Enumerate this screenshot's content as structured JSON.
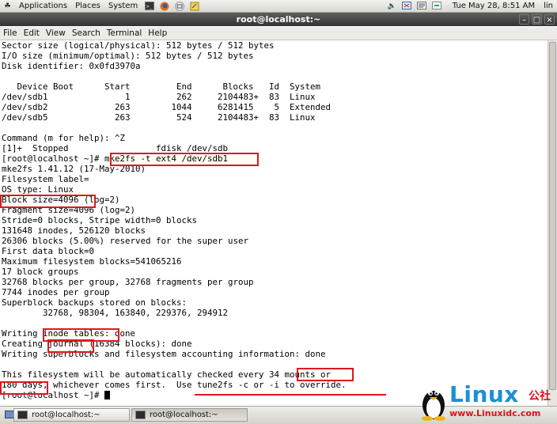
{
  "panel": {
    "applications": "Applications",
    "places": "Places",
    "system": "System",
    "clock": "Tue May 28,  8:51 AM",
    "user": "lin"
  },
  "window": {
    "title": "root@localhost:~",
    "menu": [
      "File",
      "Edit",
      "View",
      "Search",
      "Terminal",
      "Help"
    ]
  },
  "terminal": {
    "lines": [
      "Sector size (logical/physical): 512 bytes / 512 bytes",
      "I/O size (minimum/optimal): 512 bytes / 512 bytes",
      "Disk identifier: 0x0fd3970a",
      "",
      "   Device Boot      Start         End      Blocks   Id  System",
      "/dev/sdb1               1         262     2104483+  83  Linux",
      "/dev/sdb2             263        1044     6281415    5  Extended",
      "/dev/sdb5             263         524     2104483+  83  Linux",
      "",
      "Command (m for help): ^Z",
      "[1]+  Stopped                 fdisk /dev/sdb",
      "[root@localhost ~]# mke2fs -t ext4 /dev/sdb1",
      "mke2fs 1.41.12 (17-May-2010)",
      "Filesystem label=",
      "OS type: Linux",
      "Block size=4096 (log=2)",
      "Fragment size=4096 (log=2)",
      "Stride=0 blocks, Stripe width=0 blocks",
      "131648 inodes, 526120 blocks",
      "26306 blocks (5.00%) reserved for the super user",
      "First data block=0",
      "Maximum filesystem blocks=541065216",
      "17 block groups",
      "32768 blocks per group, 32768 fragments per group",
      "7744 inodes per group",
      "Superblock backups stored on blocks:",
      "        32768, 98304, 163840, 229376, 294912",
      "",
      "Writing inode tables: done",
      "Creating journal (16384 blocks): done",
      "Writing superblocks and filesystem accounting information: done",
      "",
      "This filesystem will be automatically checked every 34 mounts or",
      "180 days, whichever comes first.  Use tune2fs -c or -i to override.",
      "[root@localhost ~]# "
    ]
  },
  "taskbar": {
    "items": [
      "root@localhost:~",
      "root@localhost:~"
    ]
  },
  "watermark": {
    "brand": "Linux",
    "cn": "公社",
    "url": "www.Linuxidc.com"
  },
  "colors": {
    "annotation": "#e0161e",
    "brand_blue": "#1c8fd6"
  }
}
